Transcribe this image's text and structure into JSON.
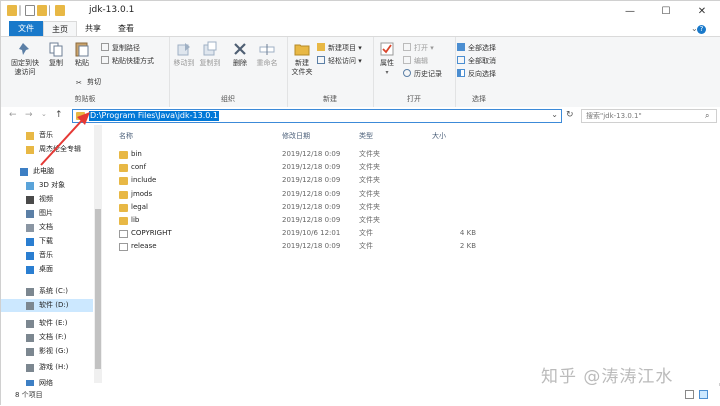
{
  "window": {
    "title": "jdk-13.0.1",
    "minimize_glyph": "—",
    "maximize_glyph": "☐",
    "close_glyph": "✕"
  },
  "ribbon_tabs": [
    "文件",
    "主页",
    "共享",
    "查看"
  ],
  "ribbon": {
    "clipboard": {
      "group_label": "剪贴板",
      "pin_label": "固定到快\n速访问",
      "copy_label": "复制",
      "paste_label": "粘贴",
      "copy_path_label": "复制路径",
      "paste_shortcut_label": "粘贴快捷方式",
      "cut_label": "剪切"
    },
    "organize": {
      "group_label": "组织",
      "move_to_label": "移动到",
      "copy_to_label": "复制到",
      "delete_label": "删除",
      "rename_label": "重命名"
    },
    "new": {
      "group_label": "新建",
      "new_folder_label": "新建\n文件夹",
      "new_item_label": "新建项目 ▾",
      "easy_access_label": "轻松访问 ▾"
    },
    "open": {
      "group_label": "打开",
      "properties_label": "属性",
      "open_label": "打开 ▾",
      "edit_label": "编辑",
      "history_label": "历史记录"
    },
    "select": {
      "group_label": "选择",
      "select_all_label": "全部选择",
      "select_none_label": "全部取消",
      "invert_label": "反向选择"
    }
  },
  "address_bar": {
    "path": "D:\\Program Files\\Java\\jdk-13.0.1",
    "search_placeholder": "搜索\"jdk-13.0.1\""
  },
  "nav_pane": {
    "items": [
      {
        "label": "音乐",
        "icon": "folder-icon"
      },
      {
        "label": "周杰伦全专辑",
        "icon": "folder-icon"
      },
      {
        "label": "此电脑",
        "icon": "computer-icon"
      },
      {
        "label": "3D 对象",
        "icon": "3d-objects-icon"
      },
      {
        "label": "视频",
        "icon": "video-icon"
      },
      {
        "label": "图片",
        "icon": "pictures-icon"
      },
      {
        "label": "文档",
        "icon": "documents-icon"
      },
      {
        "label": "下载",
        "icon": "downloads-icon"
      },
      {
        "label": "音乐",
        "icon": "music-icon"
      },
      {
        "label": "桌面",
        "icon": "desktop-icon"
      },
      {
        "label": "系统 (C:)",
        "icon": "drive-icon"
      },
      {
        "label": "软件 (D:)",
        "icon": "drive-icon",
        "selected": true
      },
      {
        "label": "软件 (E:)",
        "icon": "drive-icon"
      },
      {
        "label": "文档 (F:)",
        "icon": "drive-icon"
      },
      {
        "label": "影视 (G:)",
        "icon": "drive-icon"
      },
      {
        "label": "游戏 (H:)",
        "icon": "drive-icon"
      },
      {
        "label": "网络",
        "icon": "network-icon"
      }
    ]
  },
  "file_list": {
    "columns": [
      "名称",
      "修改日期",
      "类型",
      "大小"
    ],
    "rows": [
      {
        "name": "bin",
        "date": "2019/12/18 0:09",
        "type": "文件夹",
        "size": "",
        "kind": "folder"
      },
      {
        "name": "conf",
        "date": "2019/12/18 0:09",
        "type": "文件夹",
        "size": "",
        "kind": "folder"
      },
      {
        "name": "include",
        "date": "2019/12/18 0:09",
        "type": "文件夹",
        "size": "",
        "kind": "folder"
      },
      {
        "name": "jmods",
        "date": "2019/12/18 0:09",
        "type": "文件夹",
        "size": "",
        "kind": "folder"
      },
      {
        "name": "legal",
        "date": "2019/12/18 0:09",
        "type": "文件夹",
        "size": "",
        "kind": "folder"
      },
      {
        "name": "lib",
        "date": "2019/12/18 0:09",
        "type": "文件夹",
        "size": "",
        "kind": "folder"
      },
      {
        "name": "COPYRIGHT",
        "date": "2019/10/6 12:01",
        "type": "文件",
        "size": "4 KB",
        "kind": "file"
      },
      {
        "name": "release",
        "date": "2019/12/18 0:09",
        "type": "文件",
        "size": "2 KB",
        "kind": "file"
      }
    ]
  },
  "status_bar": {
    "item_count": "8 个项目"
  },
  "watermark": "知乎 @涛涛江水",
  "colors": {
    "accent": "#1979ca",
    "selection": "#0078d7",
    "annotation_arrow": "#e53935"
  }
}
